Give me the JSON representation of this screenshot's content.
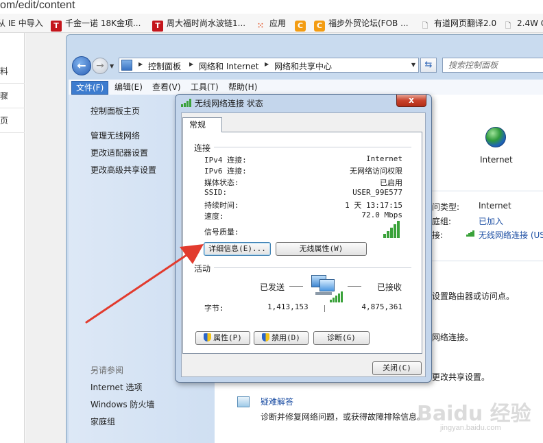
{
  "browser": {
    "url_text": "om/edit/content",
    "bookmarks": [
      {
        "label": "从 IE 中导入",
        "icon": ""
      },
      {
        "label": "千金一诺 18K金项...",
        "icon": "T"
      },
      {
        "label": "周大福时尚水波链1...",
        "icon": "T"
      },
      {
        "label": "应用",
        "icon": "apps-grid-icon"
      },
      {
        "label": "",
        "icon": "C"
      },
      {
        "label": "福步外贸论坛(FOB ...",
        "icon": "C"
      },
      {
        "label": "有道网页翻译2.0",
        "icon": "page-icon"
      },
      {
        "label": "2.4W G",
        "icon": "page-icon"
      }
    ]
  },
  "page_left_items": [
    "料",
    "骤",
    "页"
  ],
  "control_panel": {
    "breadcrumb": [
      "控制面板",
      "网络和 Internet",
      "网络和共享中心"
    ],
    "search_placeholder": "搜索控制面板",
    "menu": [
      "文件(F)",
      "编辑(E)",
      "查看(V)",
      "工具(T)",
      "帮助(H)"
    ],
    "sidebar": {
      "links": [
        "控制面板主页",
        "管理无线网络",
        "更改适配器设置",
        "更改高级共享设置"
      ],
      "see_also_title": "另请参阅",
      "see_also": [
        "Internet 选项",
        "Windows 防火墙",
        "家庭组"
      ]
    },
    "main": {
      "internet_label": "Internet",
      "access_type_label": "问类型:",
      "access_type_value": "Internet",
      "homegroup_label": "庭组:",
      "homegroup_value": "已加入",
      "connection_label": "接:",
      "connection_value": "无线网络连接 (US",
      "text_router": "设置路由器或访问点。",
      "text_network": "网络连接。",
      "text_sharing": "更改共享设置。",
      "troubleshoot_title": "疑难解答",
      "troubleshoot_desc": "诊断并修复网络问题，或获得故障排除信息。"
    }
  },
  "dialog": {
    "title": "无线网络连接 状态",
    "close_label": "x",
    "tab": "常规",
    "connection_section": "连接",
    "rows": [
      {
        "label": "IPv4 连接:",
        "value": "Internet"
      },
      {
        "label": "IPv6 连接:",
        "value": "无网络访问权限"
      },
      {
        "label": "媒体状态:",
        "value": "已启用"
      },
      {
        "label": "SSID:",
        "value": "USER_99E577"
      },
      {
        "label": "持续时间:",
        "value": "1 天 13:17:15"
      },
      {
        "label": "速度:",
        "value": "72.0 Mbps"
      }
    ],
    "signal_label": "信号质量:",
    "signal_bars": 5,
    "details_button": "详细信息(E)...",
    "wireless_props_button": "无线属性(W)",
    "activity_section": "活动",
    "sent_label": "已发送",
    "received_label": "已接收",
    "bytes_label": "字节:",
    "bytes_sent": "1,413,153",
    "bytes_received": "4,875,361",
    "properties_button": "属性(P)",
    "disable_button": "禁用(D)",
    "diagnose_button": "诊断(G)",
    "close_button": "关闭(C)"
  },
  "watermark": {
    "big": "Baidu 经验",
    "small": "jingyan.baidu.com"
  },
  "colors": {
    "menu_active": "#3d7ccf",
    "sidebar": "#dde8f6",
    "link": "#1c4ea3",
    "arrow": "#e23b2e",
    "signal": "#3aa23a"
  }
}
